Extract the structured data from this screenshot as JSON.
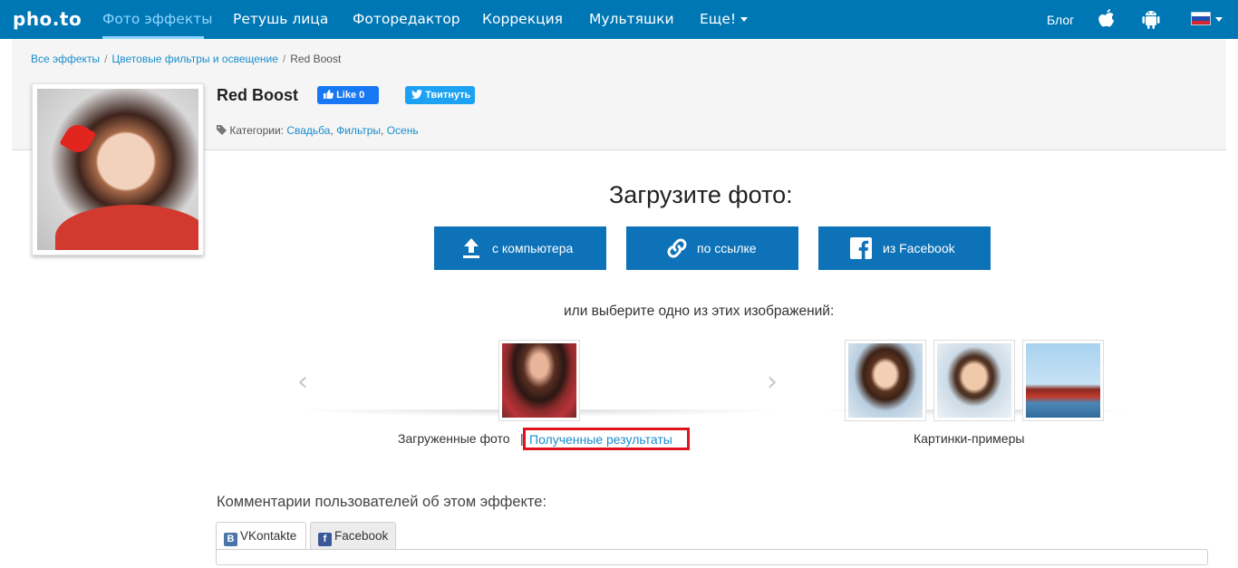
{
  "nav": {
    "logo": "pho.to",
    "items": [
      "Фото эффекты",
      "Ретушь лица",
      "Фоторедактор",
      "Коррекция",
      "Мультяшки",
      "Еще!"
    ],
    "blog": "Блог",
    "accent": "#0077b5"
  },
  "breadcrumb": {
    "items": [
      "Все эффекты",
      "Цветовые фильтры и освещение",
      "Red Boost"
    ]
  },
  "effect": {
    "title": "Red Boost",
    "like_label": "Like 0",
    "tweet_label": "Твитнуть",
    "categories_label": "Категории:",
    "categories": [
      "Свадьба",
      "Фильтры",
      "Осень"
    ]
  },
  "upload": {
    "title": "Загрузите фото:",
    "buttons": [
      "с компьютера",
      "по ссылке",
      "из Facebook"
    ],
    "choose_text": "или выберите одно из этих изображений:"
  },
  "gallery": {
    "uploaded_label": "Загруженные фото",
    "separator": "|",
    "results_link": "Полученные результаты",
    "examples_label": "Картинки-примеры",
    "prev_arrow": "‹",
    "next_arrow": "›"
  },
  "comments": {
    "title": "Комментарии пользователей об этом эффекте:",
    "tabs": [
      "VKontakte",
      "Facebook"
    ],
    "vk_badge": "B",
    "fb_badge": "f"
  }
}
